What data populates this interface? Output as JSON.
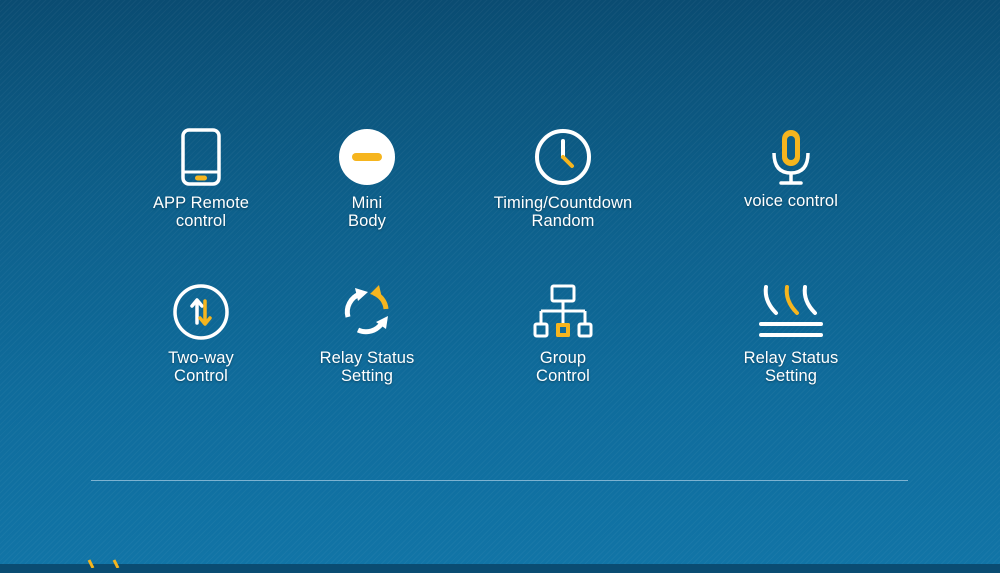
{
  "colors": {
    "icon_white": "#ffffff",
    "accent_yellow": "#f6b51e",
    "divider": "#a0c8e1"
  },
  "features": [
    {
      "icon": "smartphone-icon",
      "line1": "APP Remote",
      "line2": "control"
    },
    {
      "icon": "mini-body-icon",
      "line1": "Mini",
      "line2": "Body"
    },
    {
      "icon": "clock-icon",
      "line1": "Timing/Countdown",
      "line2": "Random"
    },
    {
      "icon": "microphone-icon",
      "line1": "voice control",
      "line2": ""
    },
    {
      "icon": "two-way-arrows-icon",
      "line1": "Two-way",
      "line2": "Control"
    },
    {
      "icon": "refresh-cycle-icon",
      "line1": "Relay Status",
      "line2": "Setting"
    },
    {
      "icon": "network-group-icon",
      "line1": "Group",
      "line2": "Control"
    },
    {
      "icon": "heat-waves-icon",
      "line1": "Relay Status",
      "line2": "Setting"
    }
  ]
}
